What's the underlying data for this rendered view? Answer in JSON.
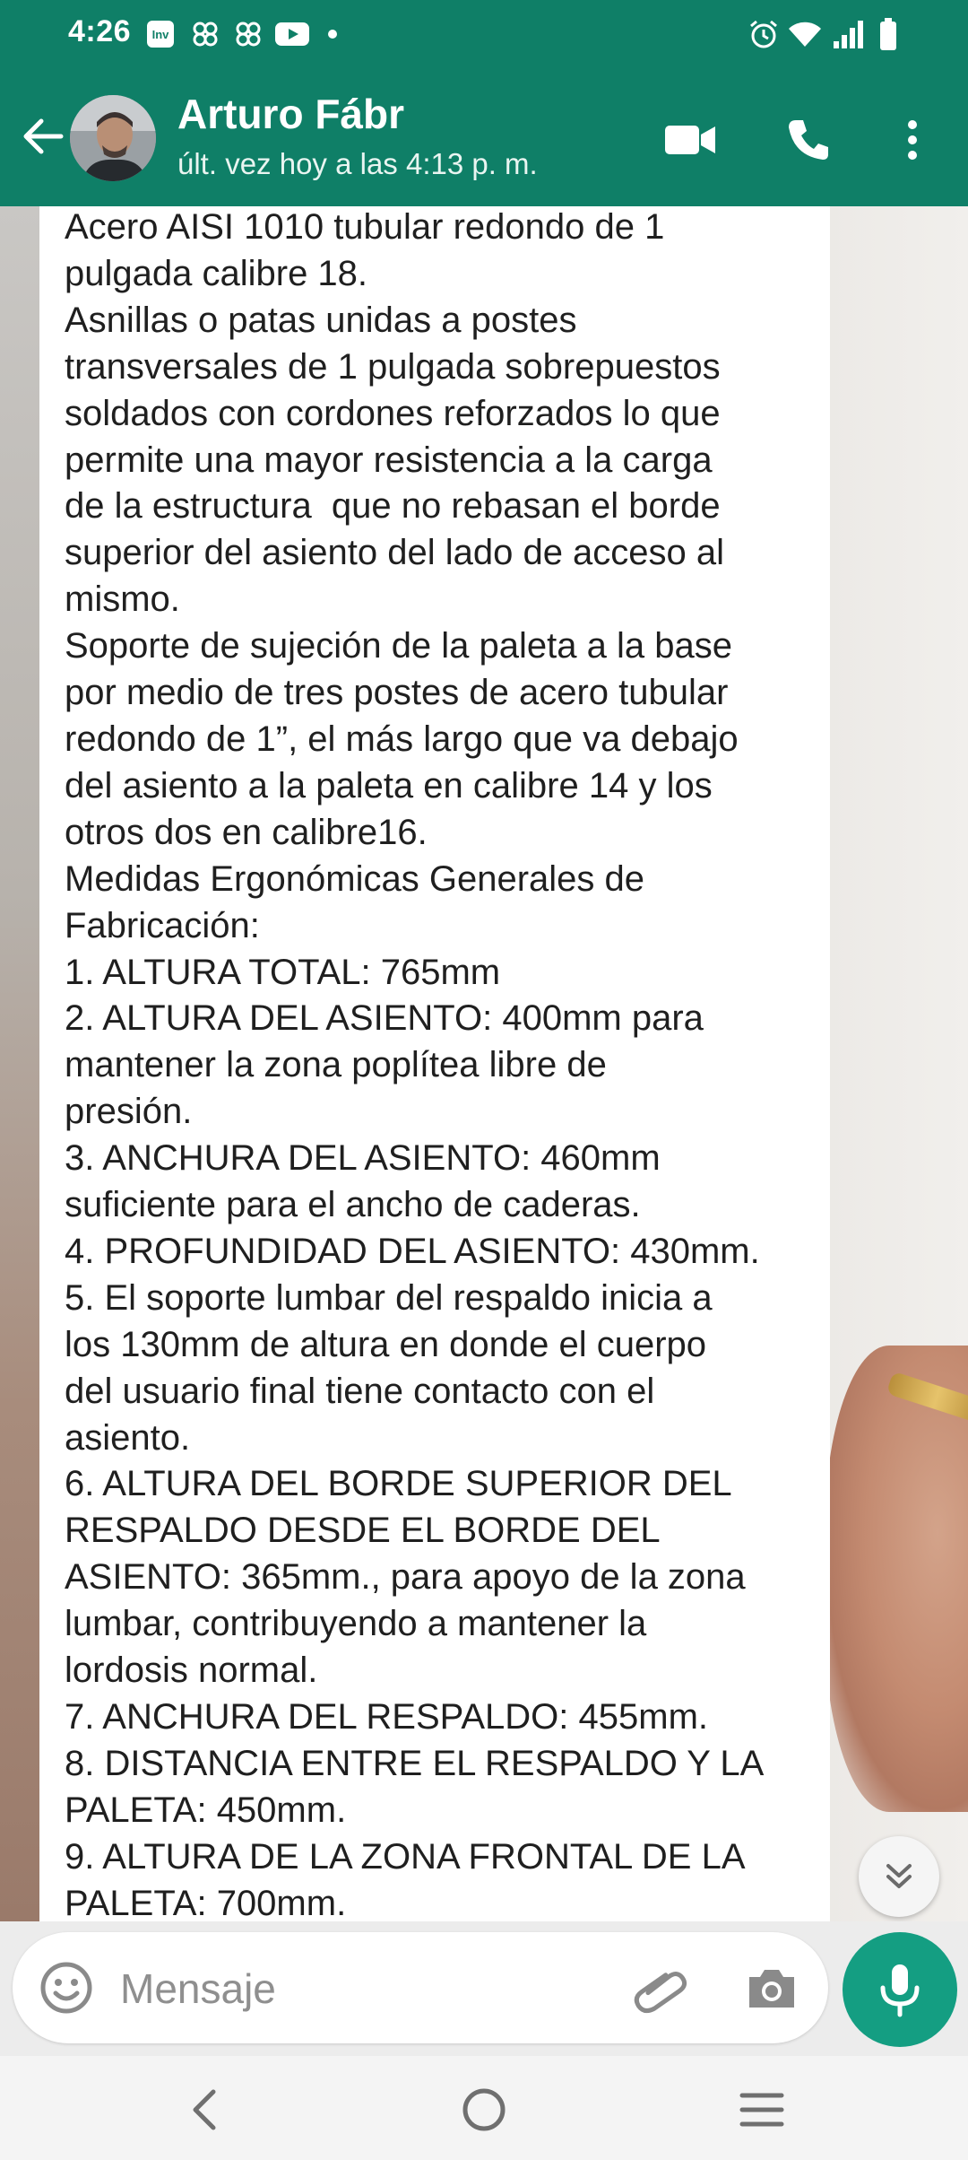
{
  "status_bar": {
    "time": "4:26",
    "notification_icons": [
      "invoice-app-icon",
      "windmill-icon",
      "windmill-icon",
      "youtube-icon",
      "dot-icon"
    ],
    "system_icons": [
      "alarm-icon",
      "wifi-icon",
      "signal-icon",
      "battery-icon"
    ]
  },
  "header": {
    "contact_name": "Arturo Fábr",
    "last_seen": "últ. vez hoy a las 4:13 p. m.",
    "icons": [
      "back-arrow-icon",
      "avatar",
      "video-call-icon",
      "voice-call-icon",
      "more-options-icon"
    ]
  },
  "message": {
    "text": "Acero AISI 1010 tubular redondo de 1\npulgada calibre 18.\nAsnillas o patas unidas a postes\ntransversales de 1 pulgada sobrepuestos\nsoldados con cordones reforzados lo que\npermite una mayor resistencia a la carga\nde la estructura  que no rebasan el borde\nsuperior del asiento del lado de acceso al\nmismo.\nSoporte de sujeción de la paleta a la base\npor medio de tres postes de acero tubular\nredondo de 1”, el más largo que va debajo\ndel asiento a la paleta en calibre 14 y los\notros dos en calibre16.\nMedidas Ergonómicas Generales de\nFabricación:\n1. ALTURA TOTAL: 765mm\n2. ALTURA DEL ASIENTO: 400mm para\nmantener la zona poplítea libre de\npresión.\n3. ANCHURA DEL ASIENTO: 460mm\nsuficiente para el ancho de caderas.\n4. PROFUNDIDAD DEL ASIENTO: 430mm.\n5. El soporte lumbar del respaldo inicia a\nlos 130mm de altura en donde el cuerpo\ndel usuario final tiene contacto con el\nasiento.\n6. ALTURA DEL BORDE SUPERIOR DEL\nRESPALDO DESDE EL BORDE DEL\nASIENTO: 365mm., para apoyo de la zona\nlumbar, contribuyendo a mantener la\nlordosis normal.\n7. ANCHURA DEL RESPALDO: 455mm.\n8. DISTANCIA ENTRE EL RESPALDO Y LA\nPALETA: 450mm.\n9. ALTURA DE LA ZONA FRONTAL DE LA\nPALETA: 700mm."
  },
  "composer": {
    "placeholder": "Mensaje",
    "icons": [
      "emoji-icon",
      "attach-icon",
      "camera-icon",
      "mic-icon"
    ]
  },
  "scroll_button_icon": "double-chevron-down-icon",
  "nav_bar": {
    "icons": [
      "nav-back-icon",
      "nav-home-icon",
      "nav-recents-icon"
    ]
  },
  "colors": {
    "header": "#0f7f67",
    "mic_button": "#149e82",
    "bubble": "#ffffff",
    "composer_bg": "#ececec"
  }
}
